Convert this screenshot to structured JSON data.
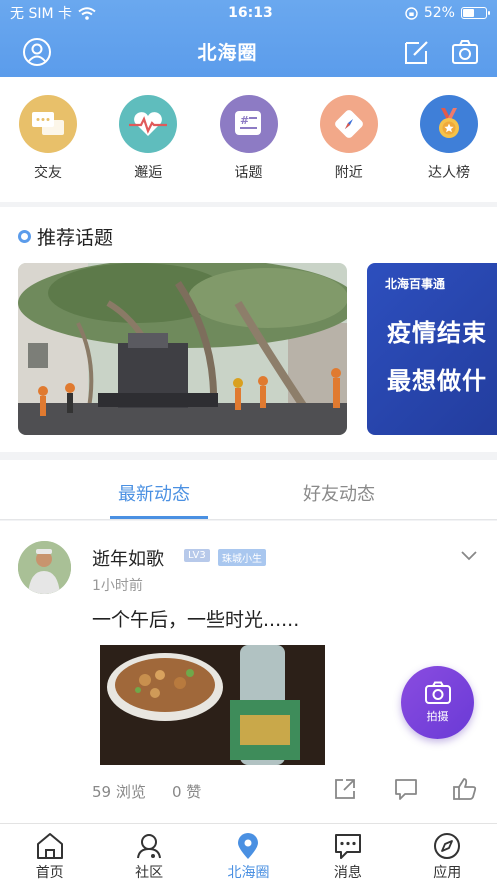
{
  "status_bar": {
    "carrier": "无 SIM 卡",
    "time": "16:13",
    "battery_percent": "52%",
    "battery_level": 0.52
  },
  "navbar": {
    "title": "北海圈"
  },
  "categories": [
    {
      "label": "交友",
      "color": "#e8c06a",
      "icon": "chat-bubbles-icon"
    },
    {
      "label": "邂逅",
      "color": "#5fbdbd",
      "icon": "heartbeat-icon"
    },
    {
      "label": "话题",
      "color": "#8d7bc4",
      "icon": "hashtag-icon"
    },
    {
      "label": "附近",
      "color": "#f2a889",
      "icon": "compass-icon"
    },
    {
      "label": "达人榜",
      "color": "#3f7fd8",
      "icon": "medal-icon"
    }
  ],
  "topics": {
    "title": "推荐话题",
    "banner2": {
      "logo": "北海百事通",
      "line1": "疫情结束",
      "line2": "最想做什"
    }
  },
  "tabs": {
    "active": "最新动态",
    "inactive": "好友动态"
  },
  "post": {
    "username": "逝年如歌",
    "level": "LV3",
    "tag": "珠城小生",
    "time": "1小时前",
    "text": "一个午后，一些时光......",
    "views": "59 浏览",
    "likes": "0 赞"
  },
  "fab": {
    "label": "拍摄"
  },
  "bottom_nav": [
    {
      "label": "首页",
      "icon": "home-icon"
    },
    {
      "label": "社区",
      "icon": "community-icon"
    },
    {
      "label": "北海圈",
      "icon": "location-pin-icon"
    },
    {
      "label": "消息",
      "icon": "message-icon"
    },
    {
      "label": "应用",
      "icon": "compass-app-icon"
    }
  ],
  "colors": {
    "primary": "#5b9ceb",
    "accent_tab": "#4a90e2",
    "fab": "#7a44dc"
  }
}
